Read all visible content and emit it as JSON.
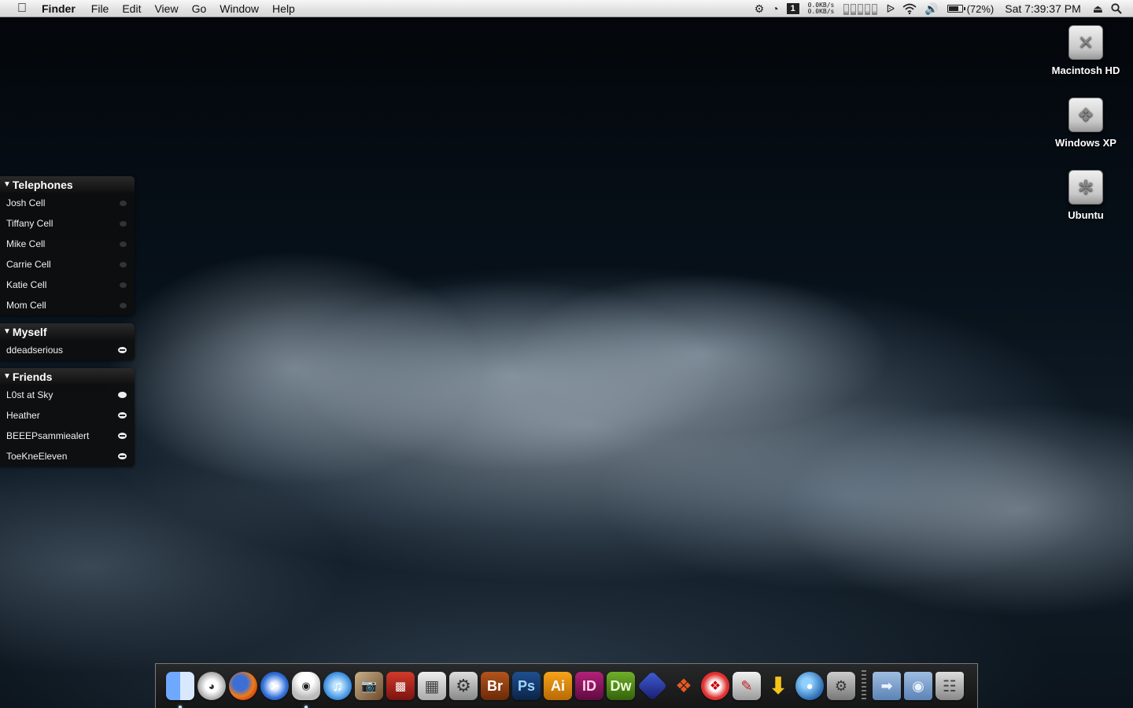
{
  "menubar": {
    "apple_icon": "apple-icon",
    "app_name": "Finder",
    "menus": [
      "File",
      "Edit",
      "View",
      "Go",
      "Window",
      "Help"
    ],
    "net_up": "0.0KB/s",
    "net_down": "0.0KB/s",
    "battery_percent": "(72%)",
    "battery_level": 0.72,
    "clock": "Sat 7:39:37 PM"
  },
  "desktop_icons": [
    {
      "label": "Macintosh HD",
      "icon": "hard-drive-icon"
    },
    {
      "label": "Windows XP",
      "icon": "windows-drive-icon"
    },
    {
      "label": "Ubuntu",
      "icon": "ubuntu-drive-icon"
    }
  ],
  "buddy_list": {
    "telephones": {
      "title": "Telephones",
      "items": [
        "Josh Cell",
        "Tiffany Cell",
        "Mike Cell",
        "Carrie Cell",
        "Katie Cell",
        "Mom Cell"
      ]
    },
    "myself": {
      "title": "Myself",
      "items": [
        "ddeadserious"
      ]
    },
    "friends": {
      "title": "Friends",
      "items": [
        "L0st at Sky",
        "Heather",
        "BEEEPsammiealert",
        "ToeKneEleven"
      ]
    }
  },
  "dock": {
    "bridge_label": "Br",
    "photoshop_label": "Ps",
    "illustrator_label": "Ai",
    "indesign_label": "ID",
    "dreamweaver_label": "Dw"
  }
}
